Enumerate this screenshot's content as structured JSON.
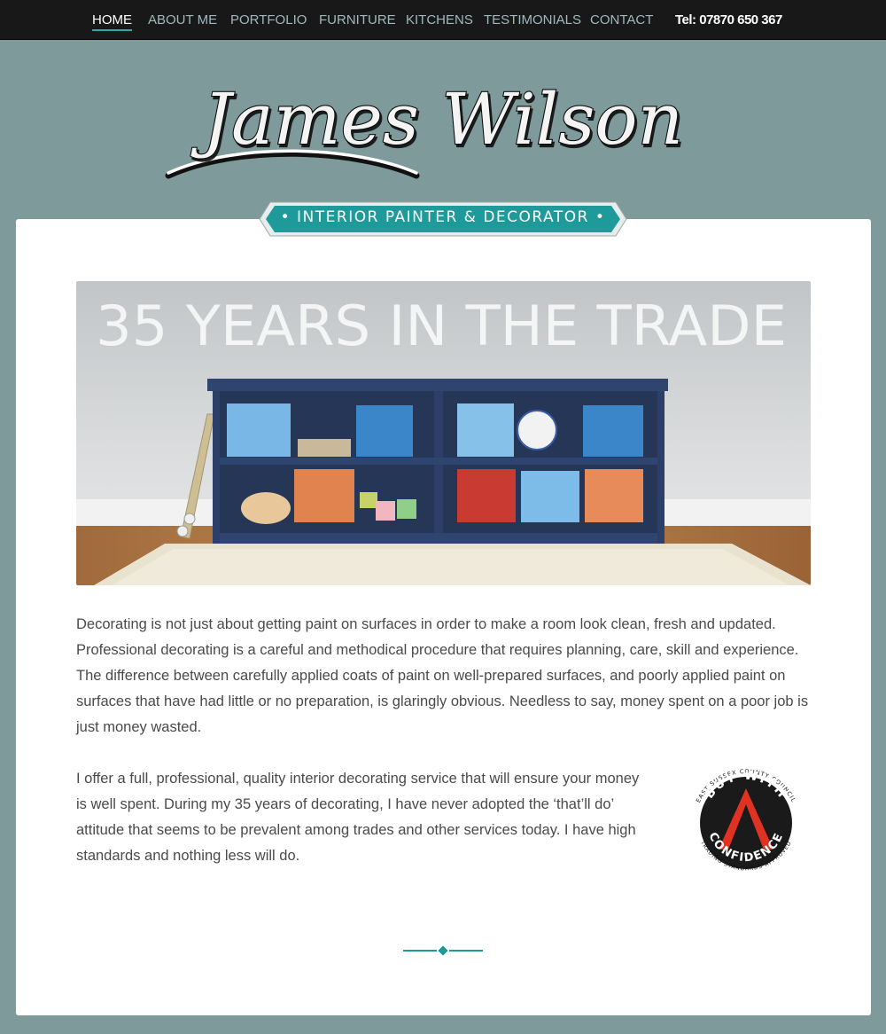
{
  "nav": {
    "items": [
      {
        "label": "HOME",
        "active": true
      },
      {
        "label": "ABOUT ME",
        "active": false
      },
      {
        "label": "PORTFOLIO",
        "active": false
      },
      {
        "label": "FURNITURE",
        "active": false
      },
      {
        "label": "KITCHENS",
        "active": false
      },
      {
        "label": "TESTIMONIALS",
        "active": false
      },
      {
        "label": "CONTACT",
        "active": false
      }
    ],
    "phone": "Tel: 07870 650 367"
  },
  "logo": {
    "text": "James Wilson"
  },
  "tagline": "• INTERIOR PAINTER & DECORATOR •",
  "hero": {
    "heading": "35 YEARS IN THE TRADE"
  },
  "content": {
    "paragraph_1": "Decorating is not just about getting paint on surfaces in order to make a room look clean, fresh and updated. Professional decorating is a careful and methodical procedure that requires planning, care, skill and experience. The difference between carefully applied coats of paint on well-prepared surfaces, and poorly applied paint on surfaces that have had little or no preparation, is glaringly obvious. Needless to say, money spent on a poor job is just money wasted.",
    "paragraph_2": "I offer a full, professional, quality interior decorating service that will ensure your money is well spent. During my 35 years of decorating, I have never adopted the ‘that’ll do’ attitude that seems to be prevalent among trades and other services today. I have high standards and nothing less will do."
  },
  "badge": {
    "top_text": "EAST SUSSEX COUNTY COUNCIL",
    "main_top": "BUY WITH",
    "main_bottom": "CONFIDENCE",
    "bottom_text": "TRADING STANDARDS APPROVED"
  },
  "colors": {
    "background": "#7e9a9b",
    "nav_background": "#181818",
    "accent_teal": "#1f9a9a",
    "text": "#4a4a4a"
  }
}
